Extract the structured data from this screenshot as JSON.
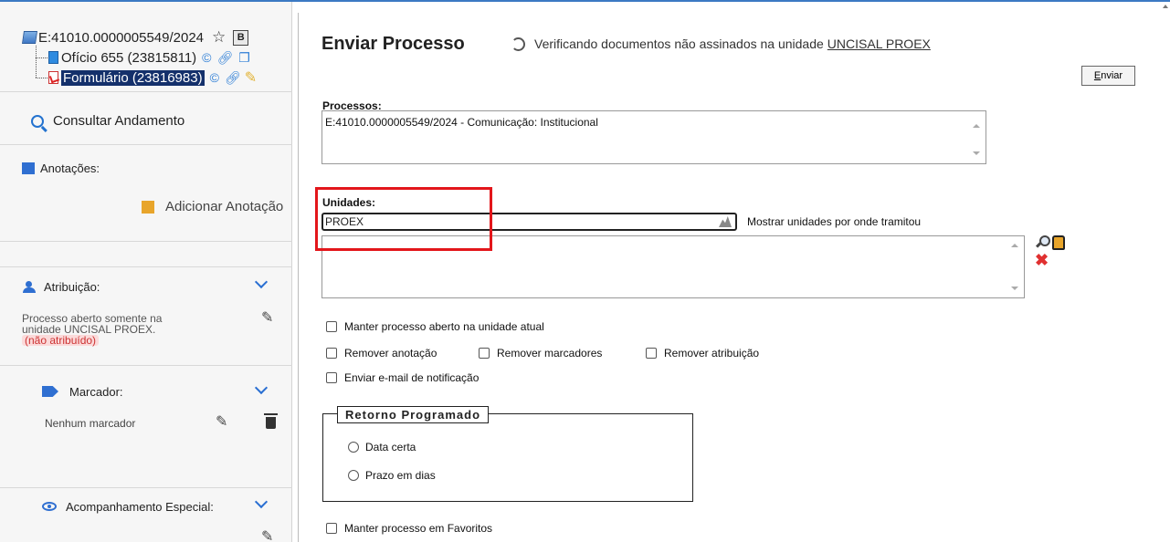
{
  "tree": {
    "process_number": "E:41010.0000005549/2024",
    "badge": "B",
    "doc1": "Ofício 655 (23815811)",
    "doc2": "Formulário (23816983)"
  },
  "sidebar": {
    "consultar": "Consultar Andamento",
    "anotacoes_label": "Anotações:",
    "adicionar_anotacao": "Adicionar Anotação",
    "atribuicao_label": "Atribuição:",
    "atribuicao_text1": "Processo aberto somente na",
    "atribuicao_text2": "unidade UNCISAL PROEX.",
    "nao_atribuido": "(não atribuído)",
    "marcador_label": "Marcador:",
    "nenhum_marcador": "Nenhum marcador",
    "acompanhamento_label": "Acompanhamento Especial:"
  },
  "main": {
    "title": "Enviar Processo",
    "verificando": "Verificando documentos não assinados na unidade",
    "unidade_link": "UNCISAL PROEX",
    "enviar_first": "E",
    "enviar_rest": "nviar",
    "processos_label": "Processos:",
    "processos_value": "E:41010.0000005549/2024 - Comunicação: Institucional",
    "unidades_label": "Unidades:",
    "unidades_value": "PROEX",
    "mostrar_unidades": "Mostrar unidades por onde tramitou",
    "manter_aberto": "Manter processo aberto na unidade atual",
    "remover_anotacao": "Remover anotação",
    "remover_marcadores": "Remover marcadores",
    "remover_atribuicao": "Remover atribuição",
    "enviar_email": "Enviar e-mail de notificação",
    "retorno_programado": "Retorno Programado",
    "data_certa": "Data certa",
    "prazo_dias": "Prazo em dias",
    "manter_favoritos": "Manter processo em Favoritos"
  },
  "colors": {
    "accent_blue": "#2f6fd1",
    "highlight_red": "#e3161b",
    "selection_navy": "#14306b"
  }
}
